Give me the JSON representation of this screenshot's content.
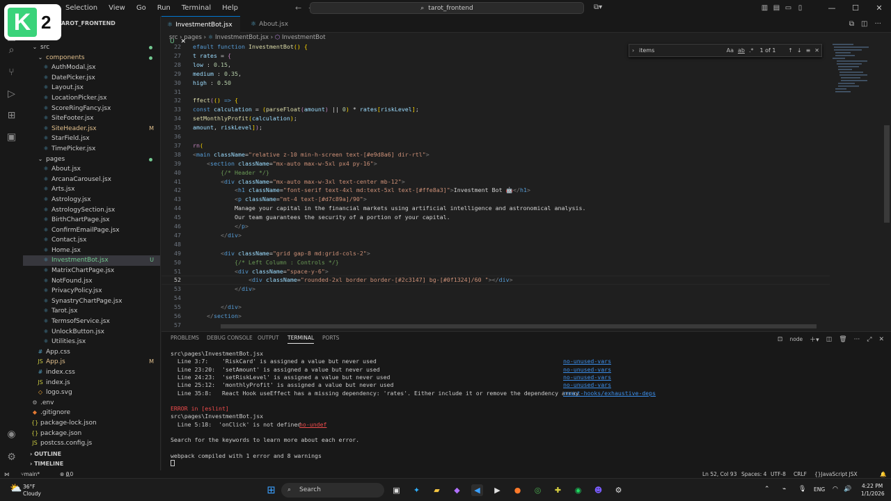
{
  "titlebar": {
    "menu": [
      "Selection",
      "View",
      "Go",
      "Run",
      "Terminal",
      "Help"
    ],
    "command_center": "tarot_frontend"
  },
  "sidebar": {
    "header": "TAROT_FRONTEND",
    "items": [
      {
        "label": "src",
        "kind": "folder",
        "indent": 0,
        "status": "dot"
      },
      {
        "label": "components",
        "kind": "folder",
        "indent": 1,
        "status": "dot",
        "color": "mod"
      },
      {
        "label": "AuthModal.jsx",
        "kind": "jsx",
        "indent": 2
      },
      {
        "label": "DatePicker.jsx",
        "kind": "jsx",
        "indent": 2
      },
      {
        "label": "Layout.jsx",
        "kind": "jsx",
        "indent": 2
      },
      {
        "label": "LocationPicker.jsx",
        "kind": "jsx",
        "indent": 2
      },
      {
        "label": "ScoreRingFancy.jsx",
        "kind": "jsx",
        "indent": 2
      },
      {
        "label": "SiteFooter.jsx",
        "kind": "jsx",
        "indent": 2
      },
      {
        "label": "SiteHeader.jsx",
        "kind": "jsx",
        "indent": 2,
        "status": "M",
        "color": "mod"
      },
      {
        "label": "StarField.jsx",
        "kind": "jsx",
        "indent": 2
      },
      {
        "label": "TimePicker.jsx",
        "kind": "jsx",
        "indent": 2
      },
      {
        "label": "pages",
        "kind": "folder",
        "indent": 1,
        "status": "dot"
      },
      {
        "label": "About.jsx",
        "kind": "jsx",
        "indent": 2
      },
      {
        "label": "ArcanaCarousel.jsx",
        "kind": "jsx",
        "indent": 2
      },
      {
        "label": "Arts.jsx",
        "kind": "jsx",
        "indent": 2
      },
      {
        "label": "Astrology.jsx",
        "kind": "jsx",
        "indent": 2
      },
      {
        "label": "AstrologySection.jsx",
        "kind": "jsx",
        "indent": 2
      },
      {
        "label": "BirthChartPage.jsx",
        "kind": "jsx",
        "indent": 2
      },
      {
        "label": "ConfirmEmailPage.jsx",
        "kind": "jsx",
        "indent": 2
      },
      {
        "label": "Contact.jsx",
        "kind": "jsx",
        "indent": 2
      },
      {
        "label": "Home.jsx",
        "kind": "jsx",
        "indent": 2
      },
      {
        "label": "InvestmentBot.jsx",
        "kind": "jsx",
        "indent": 2,
        "status": "U",
        "active": true
      },
      {
        "label": "MatrixChartPage.jsx",
        "kind": "jsx",
        "indent": 2
      },
      {
        "label": "NotFound.jsx",
        "kind": "jsx",
        "indent": 2
      },
      {
        "label": "PrivacyPolicy.jsx",
        "kind": "jsx",
        "indent": 2
      },
      {
        "label": "SynastryChartPage.jsx",
        "kind": "jsx",
        "indent": 2
      },
      {
        "label": "Tarot.jsx",
        "kind": "jsx",
        "indent": 2
      },
      {
        "label": "TermsofService.jsx",
        "kind": "jsx",
        "indent": 2
      },
      {
        "label": "UnlockButton.jsx",
        "kind": "jsx",
        "indent": 2
      },
      {
        "label": "Utilities.jsx",
        "kind": "jsx",
        "indent": 2
      },
      {
        "label": "App.css",
        "kind": "css",
        "indent": 1
      },
      {
        "label": "App.js",
        "kind": "js",
        "indent": 1,
        "status": "M",
        "color": "mod"
      },
      {
        "label": "index.css",
        "kind": "css",
        "indent": 1
      },
      {
        "label": "index.js",
        "kind": "js",
        "indent": 1
      },
      {
        "label": "logo.svg",
        "kind": "svg",
        "indent": 1
      },
      {
        "label": ".env",
        "kind": "env",
        "indent": 0
      },
      {
        "label": ".gitignore",
        "kind": "git",
        "indent": 0
      },
      {
        "label": "package-lock.json",
        "kind": "json",
        "indent": 0
      },
      {
        "label": "package.json",
        "kind": "json",
        "indent": 0
      },
      {
        "label": "postcss.config.js",
        "kind": "js",
        "indent": 0
      }
    ],
    "outline": "OUTLINE",
    "timeline": "TIMELINE"
  },
  "tabs": [
    {
      "label": "InvestmentBot.jsx",
      "status": "U",
      "active": true
    },
    {
      "label": "About.jsx",
      "active": false
    }
  ],
  "breadcrumb": [
    "src",
    "pages",
    "InvestmentBot.jsx",
    "InvestmentBot"
  ],
  "find": {
    "value": "items",
    "result": "1 of 1",
    "opts": [
      "Aa",
      "ab",
      ".*"
    ]
  },
  "code": [
    {
      "ln": "22",
      "html": "<span class='k'>efault</span> <span class='k'>function</span> <span class='fn'>InvestmentBot</span><span class='y'>()</span> <span class='y'>{</span>"
    },
    {
      "ln": "27",
      "html": "<span class='v'>t</span> <span class='v'>rates</span> = <span class='kf'>{</span>"
    },
    {
      "ln": "28",
      "html": "<span class='v'>low</span> : <span class='n'>0.15</span>,"
    },
    {
      "ln": "29",
      "html": "<span class='v'>medium</span> : <span class='n'>0.35</span>,"
    },
    {
      "ln": "30",
      "html": "<span class='v'>high</span> : <span class='n'>0.50</span>"
    },
    {
      "ln": "31",
      "html": ""
    },
    {
      "ln": "32",
      "html": "<span class='fn'>ffect</span><span class='kf'>(</span><span class='y'>()</span> <span class='k'>=&gt;</span> <span class='y'>{</span>"
    },
    {
      "ln": "33",
      "html": "<span class='k'>const</span> <span class='v'>calculation</span> = <span class='y'>(</span><span class='fn'>parseFloat</span><span class='kf'>(</span><span class='v'>amount</span><span class='kf'>)</span> || <span class='n'>0</span><span class='y'>)</span> * <span class='v'>rates</span><span class='y'>[</span><span class='v'>riskLevel</span><span class='y'>]</span>;"
    },
    {
      "ln": "34",
      "html": "<span class='fn'>setMonthlyProfit</span><span class='y'>(</span><span class='v'>calculation</span><span class='y'>)</span>;"
    },
    {
      "ln": "35",
      "html": "<span class='v'>amount</span>, <span class='v'>riskLevel</span><span class='y'>]</span><span class='kf'>)</span>;"
    },
    {
      "ln": "36",
      "html": ""
    },
    {
      "ln": "37",
      "html": "<span class='kf'>rn</span><span class='y'>(</span>"
    },
    {
      "ln": "38",
      "html": "<span class='p'>&lt;</span><span class='t'>main</span> <span class='a'>className</span>=<span class='s'>\"relative z-10 min-h-screen text-[#e9d8a6] dir-rtl\"</span><span class='p'>&gt;</span>"
    },
    {
      "ln": "39",
      "html": "    <span class='p'>&lt;</span><span class='t'>section</span> <span class='a'>className</span>=<span class='s'>\"mx-auto max-w-5xl px4 py-16\"</span><span class='p'>&gt;</span>"
    },
    {
      "ln": "40",
      "html": "        <span class='cm'>{/* Header */}</span>"
    },
    {
      "ln": "41",
      "html": "        <span class='p'>&lt;</span><span class='t'>div</span> <span class='a'>className</span>=<span class='s'>\"mx-auto max-w-3xl text-center mb-12\"</span><span class='p'>&gt;</span>"
    },
    {
      "ln": "42",
      "html": "            <span class='p'>&lt;</span><span class='t'>h1</span> <span class='a'>className</span>=<span class='s'>\"font-serif text-4xl md:text-5xl text-[#ffe8a3]\"</span><span class='p'>&gt;</span><span class='txt'>Investment Bot 🤖</span><span class='p'>&lt;/</span><span class='t'>h1</span><span class='p'>&gt;</span>"
    },
    {
      "ln": "43",
      "html": "            <span class='p'>&lt;</span><span class='t'>p</span> <span class='a'>className</span>=<span class='s'>\"mt-4 text-[#d7c89a]/90\"</span><span class='p'>&gt;</span>"
    },
    {
      "ln": "44",
      "html": "            <span class='txt'>Manage your capital in the financial markets using artificial intelligence and astronomical analysis.</span>"
    },
    {
      "ln": "45",
      "html": "            <span class='txt'>Our team guarantees the security of a portion of your capital.</span>"
    },
    {
      "ln": "46",
      "html": "            <span class='p'>&lt;/</span><span class='t'>p</span><span class='p'>&gt;</span>"
    },
    {
      "ln": "47",
      "html": "        <span class='p'>&lt;/</span><span class='t'>div</span><span class='p'>&gt;</span>"
    },
    {
      "ln": "48",
      "html": ""
    },
    {
      "ln": "49",
      "html": "        <span class='p'>&lt;</span><span class='t'>div</span> <span class='a'>className</span>=<span class='s'>\"grid gap-8 md:grid-cols-2\"</span><span class='p'>&gt;</span>"
    },
    {
      "ln": "50",
      "html": "            <span class='cm'>{/* Left Column : Controls */}</span>"
    },
    {
      "ln": "51",
      "html": "            <span class='p'>&lt;</span><span class='t'>div</span> <span class='a'>className</span>=<span class='s'>\"space-y-6\"</span><span class='p'>&gt;</span>"
    },
    {
      "ln": "52",
      "html": "                <span class='p'>&lt;</span><span class='t'>div</span> <span class='a'>className</span>=<span class='s'>\"rounded-2xl border border-[#2c3147] bg-[#0f1324]/60 \"</span><span class='p'>&gt;&lt;/</span><span class='t'>div</span><span class='p'>&gt;</span>",
      "current": true
    },
    {
      "ln": "53",
      "html": "            <span class='p'>&lt;/</span><span class='t'>div</span><span class='p'>&gt;</span>"
    },
    {
      "ln": "54",
      "html": ""
    },
    {
      "ln": "55",
      "html": "        <span class='p'>&lt;/</span><span class='t'>div</span><span class='p'>&gt;</span>"
    },
    {
      "ln": "56",
      "html": "    <span class='p'>&lt;/</span><span class='t'>section</span><span class='p'>&gt;</span>"
    },
    {
      "ln": "57",
      "html": ""
    }
  ],
  "panel": {
    "tabs": [
      "PROBLEMS",
      "DEBUG CONSOLE",
      "OUTPUT",
      "TERMINAL",
      "PORTS"
    ],
    "active_tab": "TERMINAL",
    "shell": "node",
    "lines": [
      {
        "text": "src\\pages\\InvestmentBot.jsx"
      },
      {
        "text": "  Line 3:7:    'RiskCard' is assigned a value but never used",
        "rule": "no-unused-vars"
      },
      {
        "text": "  Line 23:20:  'setAmount' is assigned a value but never used",
        "rule": "no-unused-vars"
      },
      {
        "text": "  Line 24:23:  'setRiskLevel' is assigned a value but never used",
        "rule": "no-unused-vars"
      },
      {
        "text": "  Line 25:12:  'monthlyProfit' is assigned a value but never used",
        "rule": "no-unused-vars"
      },
      {
        "text": "  Line 35:8:   React Hook useEffect has a missing dependency: 'rates'. Either include it or remove the dependency array",
        "rule": "react-hooks/exhaustive-deps"
      },
      {
        "text": ""
      },
      {
        "text": "ERROR in [eslint]"
      },
      {
        "text": "src\\pages\\InvestmentBot.jsx"
      },
      {
        "text": "  Line 5:18:  'onClick' is not defined",
        "rule_inline": "no-undef"
      },
      {
        "text": ""
      },
      {
        "text": "Search for the keywords to learn more about each error."
      },
      {
        "text": ""
      },
      {
        "text": "webpack compiled with 1 error and 8 warnings"
      }
    ]
  },
  "statusbar": {
    "branch": "main*",
    "errors": "0",
    "warnings": "0",
    "position": "Ln 52, Col 93",
    "spaces": "Spaces: 4",
    "encoding": "UTF-8",
    "eol": "CRLF",
    "language": "JavaScript JSX"
  },
  "taskbar": {
    "weather_temp": "36°F",
    "weather_desc": "Cloudy",
    "search": "Search",
    "lang": "ENG",
    "time": "4:22 PM",
    "date": "1/1/2026"
  }
}
